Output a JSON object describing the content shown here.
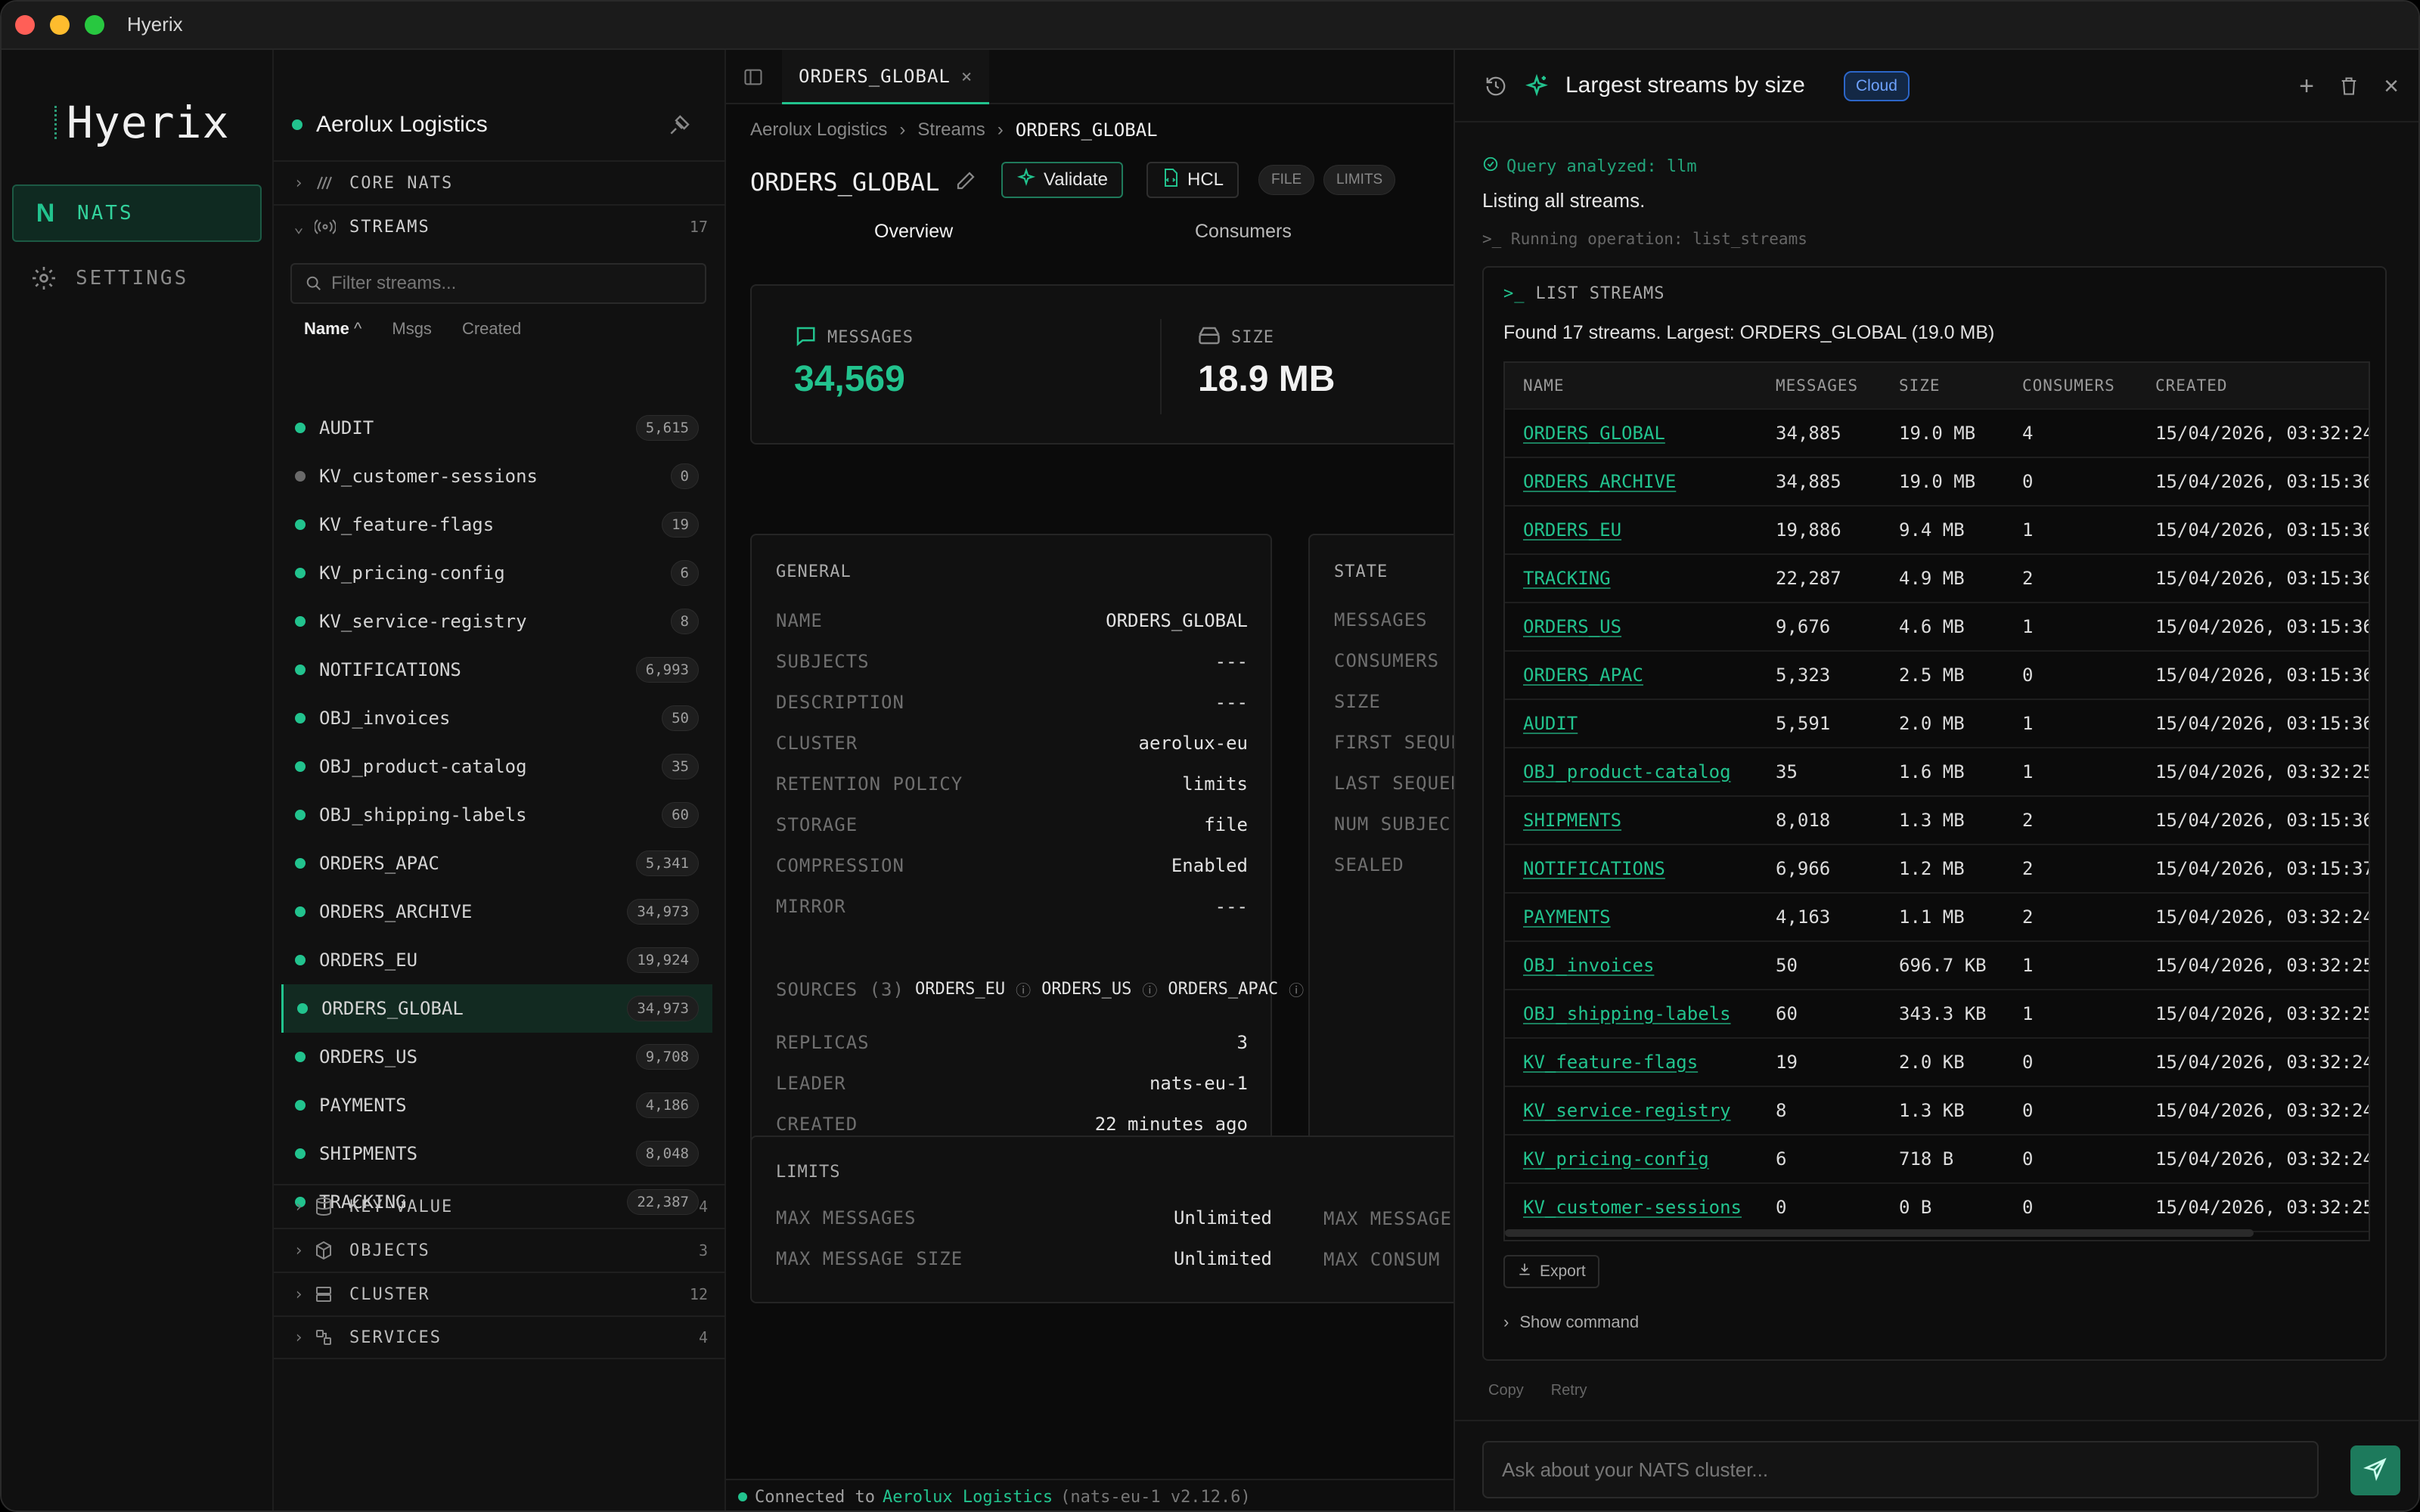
{
  "window": {
    "title": "Hyerix"
  },
  "nav": {
    "logo": "Hyerix",
    "items": [
      {
        "label": "NATS",
        "icon": "nats-n-icon",
        "active": true
      },
      {
        "label": "SETTINGS",
        "icon": "gear-icon",
        "active": false
      }
    ]
  },
  "connection": {
    "name": "Aerolux Logistics",
    "status_color": "#22c38e"
  },
  "sections": {
    "core_nats": {
      "label": "CORE NATS"
    },
    "streams": {
      "label": "STREAMS",
      "count": "17"
    },
    "key_value": {
      "label": "KEY-VALUE",
      "count": "4"
    },
    "objects": {
      "label": "OBJECTS",
      "count": "3"
    },
    "cluster": {
      "label": "CLUSTER",
      "count": "12"
    },
    "services": {
      "label": "SERVICES",
      "count": "4"
    }
  },
  "filter": {
    "placeholder": "Filter streams..."
  },
  "sort": {
    "name": "Name",
    "msgs": "Msgs",
    "created": "Created"
  },
  "streams": [
    {
      "name": "AUDIT",
      "count": "5,615",
      "color": "#22c38e"
    },
    {
      "name": "KV_customer-sessions",
      "count": "0",
      "color": "#6a6a6a"
    },
    {
      "name": "KV_feature-flags",
      "count": "19",
      "color": "#22c38e"
    },
    {
      "name": "KV_pricing-config",
      "count": "6",
      "color": "#22c38e"
    },
    {
      "name": "KV_service-registry",
      "count": "8",
      "color": "#22c38e"
    },
    {
      "name": "NOTIFICATIONS",
      "count": "6,993",
      "color": "#22c38e"
    },
    {
      "name": "OBJ_invoices",
      "count": "50",
      "color": "#22c38e"
    },
    {
      "name": "OBJ_product-catalog",
      "count": "35",
      "color": "#22c38e"
    },
    {
      "name": "OBJ_shipping-labels",
      "count": "60",
      "color": "#22c38e"
    },
    {
      "name": "ORDERS_APAC",
      "count": "5,341",
      "color": "#22c38e"
    },
    {
      "name": "ORDERS_ARCHIVE",
      "count": "34,973",
      "color": "#22c38e"
    },
    {
      "name": "ORDERS_EU",
      "count": "19,924",
      "color": "#22c38e"
    },
    {
      "name": "ORDERS_GLOBAL",
      "count": "34,973",
      "color": "#22c38e"
    },
    {
      "name": "ORDERS_US",
      "count": "9,708",
      "color": "#22c38e"
    },
    {
      "name": "PAYMENTS",
      "count": "4,186",
      "color": "#22c38e"
    },
    {
      "name": "SHIPMENTS",
      "count": "8,048",
      "color": "#22c38e"
    },
    {
      "name": "TRACKING",
      "count": "22,387",
      "color": "#22c38e"
    }
  ],
  "tab": {
    "label": "ORDERS_GLOBAL"
  },
  "breadcrumb": [
    "Aerolux Logistics",
    "Streams",
    "ORDERS_GLOBAL"
  ],
  "page": {
    "title": "ORDERS_GLOBAL",
    "validate": "Validate",
    "hcl": "HCL",
    "pills": [
      "FILE",
      "LIMITS"
    ],
    "subtabs": [
      "Overview",
      "Consumers"
    ]
  },
  "stats": {
    "messages_label": "MESSAGES",
    "messages_value": "34,569",
    "size_label": "SIZE",
    "size_value": "18.9 MB"
  },
  "general": {
    "title": "GENERAL",
    "rows": [
      {
        "k": "NAME",
        "v": "ORDERS_GLOBAL"
      },
      {
        "k": "SUBJECTS",
        "v": "---"
      },
      {
        "k": "DESCRIPTION",
        "v": "---"
      },
      {
        "k": "CLUSTER",
        "v": "aerolux-eu"
      },
      {
        "k": "RETENTION POLICY",
        "v": "limits"
      },
      {
        "k": "STORAGE",
        "v": "file"
      },
      {
        "k": "COMPRESSION",
        "v": "Enabled"
      },
      {
        "k": "MIRROR",
        "v": "---"
      }
    ],
    "sources_label": "SOURCES (3)",
    "sources": [
      "ORDERS_EU",
      "ORDERS_US",
      "ORDERS_APAC"
    ],
    "rows2": [
      {
        "k": "REPLICAS",
        "v": "3"
      },
      {
        "k": "LEADER",
        "v": "nats-eu-1"
      },
      {
        "k": "CREATED",
        "v": "22 minutes ago"
      }
    ]
  },
  "state": {
    "title": "STATE",
    "rows": [
      "MESSAGES",
      "CONSUMERS",
      "SIZE",
      "FIRST SEQUE",
      "LAST SEQUEN",
      "NUM SUBJEC",
      "SEALED"
    ]
  },
  "limits": {
    "title": "LIMITS",
    "rows": [
      {
        "k": "MAX MESSAGES",
        "v": "Unlimited",
        "k2": "MAX MESSAGE"
      },
      {
        "k": "MAX MESSAGE SIZE",
        "v": "Unlimited",
        "k2": "MAX CONSUM"
      }
    ]
  },
  "statusbar": {
    "prefix": "Connected to",
    "name": "Aerolux Logistics",
    "suffix": "(nats-eu-1 v2.12.6)"
  },
  "ai": {
    "title": "Largest streams by size",
    "badge": "Cloud",
    "analyzed": "Query analyzed: llm",
    "answer": "Listing all streams.",
    "running": ">_ Running operation: list_streams",
    "result_title": "LIST STREAMS",
    "summary": "Found 17 streams. Largest: ORDERS_GLOBAL (19.0 MB)",
    "columns": [
      "NAME",
      "MESSAGES",
      "SIZE",
      "CONSUMERS",
      "CREATED"
    ],
    "rows": [
      [
        "ORDERS_GLOBAL",
        "34,885",
        "19.0 MB",
        "4",
        "15/04/2026, 03:32:24"
      ],
      [
        "ORDERS_ARCHIVE",
        "34,885",
        "19.0 MB",
        "0",
        "15/04/2026, 03:15:36"
      ],
      [
        "ORDERS_EU",
        "19,886",
        "9.4 MB",
        "1",
        "15/04/2026, 03:15:36"
      ],
      [
        "TRACKING",
        "22,287",
        "4.9 MB",
        "2",
        "15/04/2026, 03:15:36"
      ],
      [
        "ORDERS_US",
        "9,676",
        "4.6 MB",
        "1",
        "15/04/2026, 03:15:36"
      ],
      [
        "ORDERS_APAC",
        "5,323",
        "2.5 MB",
        "0",
        "15/04/2026, 03:15:36"
      ],
      [
        "AUDIT",
        "5,591",
        "2.0 MB",
        "1",
        "15/04/2026, 03:15:36"
      ],
      [
        "OBJ_product-catalog",
        "35",
        "1.6 MB",
        "1",
        "15/04/2026, 03:32:25"
      ],
      [
        "SHIPMENTS",
        "8,018",
        "1.3 MB",
        "2",
        "15/04/2026, 03:15:36"
      ],
      [
        "NOTIFICATIONS",
        "6,966",
        "1.2 MB",
        "2",
        "15/04/2026, 03:15:37"
      ],
      [
        "PAYMENTS",
        "4,163",
        "1.1 MB",
        "2",
        "15/04/2026, 03:32:24"
      ],
      [
        "OBJ_invoices",
        "50",
        "696.7 KB",
        "1",
        "15/04/2026, 03:32:25"
      ],
      [
        "OBJ_shipping-labels",
        "60",
        "343.3 KB",
        "1",
        "15/04/2026, 03:32:25"
      ],
      [
        "KV_feature-flags",
        "19",
        "2.0 KB",
        "0",
        "15/04/2026, 03:32:24"
      ],
      [
        "KV_service-registry",
        "8",
        "1.3 KB",
        "0",
        "15/04/2026, 03:32:24"
      ],
      [
        "KV_pricing-config",
        "6",
        "718 B",
        "0",
        "15/04/2026, 03:32:24"
      ],
      [
        "KV_customer-sessions",
        "0",
        "0 B",
        "0",
        "15/04/2026, 03:32:25"
      ]
    ],
    "export": "Export",
    "show_command": "Show command",
    "copy": "Copy",
    "retry": "Retry",
    "input_placeholder": "Ask about your NATS cluster..."
  },
  "colors": {
    "accent": "#22c38e",
    "cloud": "#6ea2ff"
  }
}
